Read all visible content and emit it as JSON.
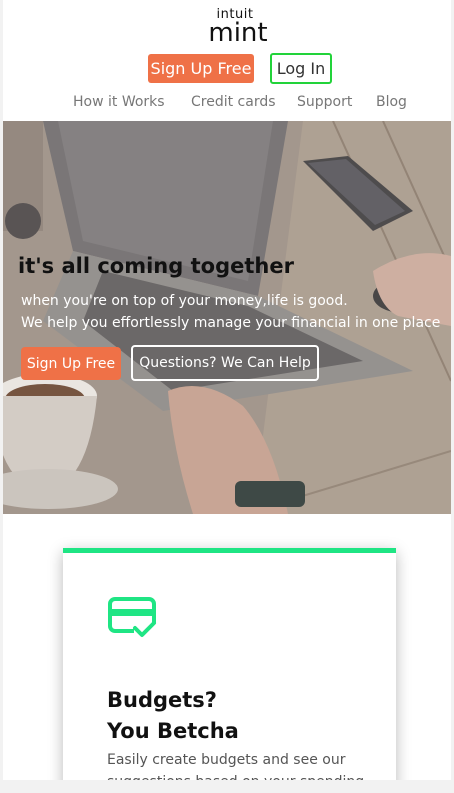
{
  "header": {
    "logo_intuit": "intuit",
    "logo_mint": "mint",
    "signup_label": "Sign Up Free",
    "login_label": "Log In"
  },
  "nav": {
    "items": [
      {
        "label": "How it Works"
      },
      {
        "label": "Credit cards"
      },
      {
        "label": "Support"
      },
      {
        "label": "Blog"
      }
    ]
  },
  "hero": {
    "title": "it's all coming together",
    "subtitle_line1": "when you're on top of your money,life is good.",
    "subtitle_line2": "We help you effortlessly manage your financial in one place",
    "signup_label": "Sign Up Free",
    "help_label": "Questions? We Can Help"
  },
  "card": {
    "icon": "credit-card-check-icon",
    "title_line1": "Budgets?",
    "title_line2": "You Betcha",
    "text": "Easily create budgets and see our suggestions based on your spending"
  },
  "colors": {
    "accent_orange": "#ef7147",
    "login_border": "#22d33a",
    "card_accent": "#1fe584"
  }
}
